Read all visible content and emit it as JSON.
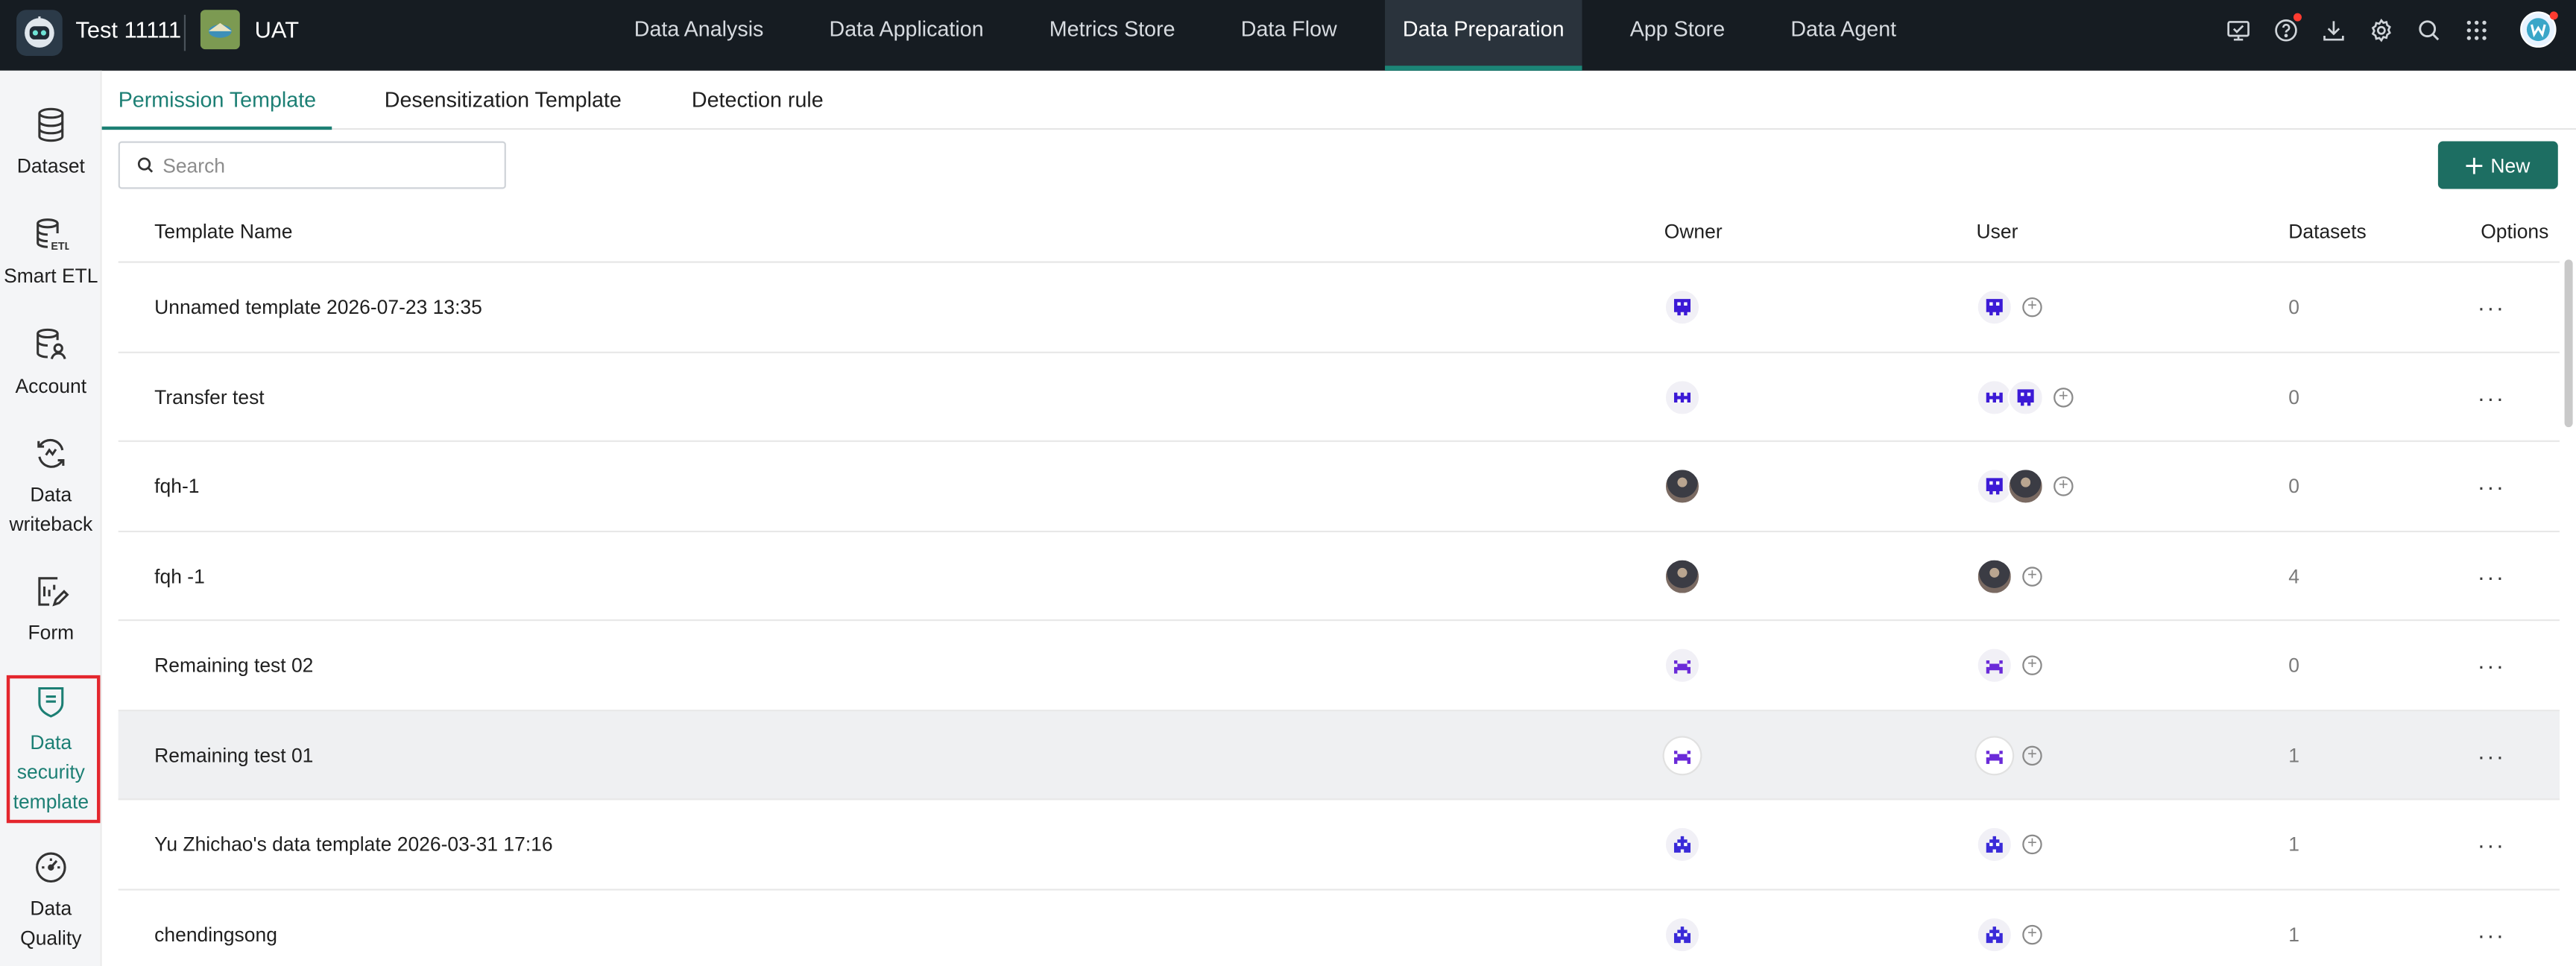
{
  "app": {
    "tenant": "Test 11111",
    "environment": "UAT"
  },
  "topnav": [
    {
      "label": "Data Analysis",
      "active": false
    },
    {
      "label": "Data Application",
      "active": false
    },
    {
      "label": "Metrics Store",
      "active": false
    },
    {
      "label": "Data Flow",
      "active": false
    },
    {
      "label": "Data Preparation",
      "active": true
    },
    {
      "label": "App Store",
      "active": false
    },
    {
      "label": "Data Agent",
      "active": false
    }
  ],
  "tools": [
    "monitor-icon",
    "help-icon",
    "download-icon",
    "settings-icon",
    "search-icon",
    "apps-grid-icon",
    "user-avatar"
  ],
  "sidebar": {
    "items": [
      {
        "label": "Dataset",
        "icon": "database-icon"
      },
      {
        "label": "Smart ETL",
        "icon": "etl-icon"
      },
      {
        "label": "Account",
        "icon": "account-icon"
      },
      {
        "label": "Data writeback",
        "icon": "writeback-icon"
      },
      {
        "label": "Form",
        "icon": "form-icon"
      },
      {
        "label": "Data security template",
        "icon": "shield-icon",
        "active": true
      },
      {
        "label": "Data Quality",
        "icon": "gauge-icon"
      }
    ]
  },
  "tabs": [
    {
      "label": "Permission Template",
      "active": true
    },
    {
      "label": "Desensitization Template",
      "active": false
    },
    {
      "label": "Detection rule",
      "active": false
    }
  ],
  "search": {
    "placeholder": "Search",
    "value": ""
  },
  "new_button": {
    "label": "New"
  },
  "table": {
    "columns": [
      "Template Name",
      "Owner",
      "User",
      "Datasets",
      "Options"
    ],
    "rows": [
      {
        "name": "Unnamed template 2026-07-23 13:35",
        "datasets": "0"
      },
      {
        "name": "Transfer test",
        "datasets": "0"
      },
      {
        "name": "fqh-1",
        "datasets": "0"
      },
      {
        "name": "fqh -1",
        "datasets": "4"
      },
      {
        "name": "Remaining test 02",
        "datasets": "0"
      },
      {
        "name": "Remaining test 01",
        "datasets": "1"
      },
      {
        "name": "Yu Zhichao's data template 2026-03-31 17:16",
        "datasets": "1"
      },
      {
        "name": "chendingsong",
        "datasets": "1"
      }
    ],
    "options_label": "···"
  },
  "colors": {
    "accent": "#1c7f74",
    "topbar": "#161c22",
    "new_button": "#1d6e62",
    "highlight": "#e4262d"
  }
}
